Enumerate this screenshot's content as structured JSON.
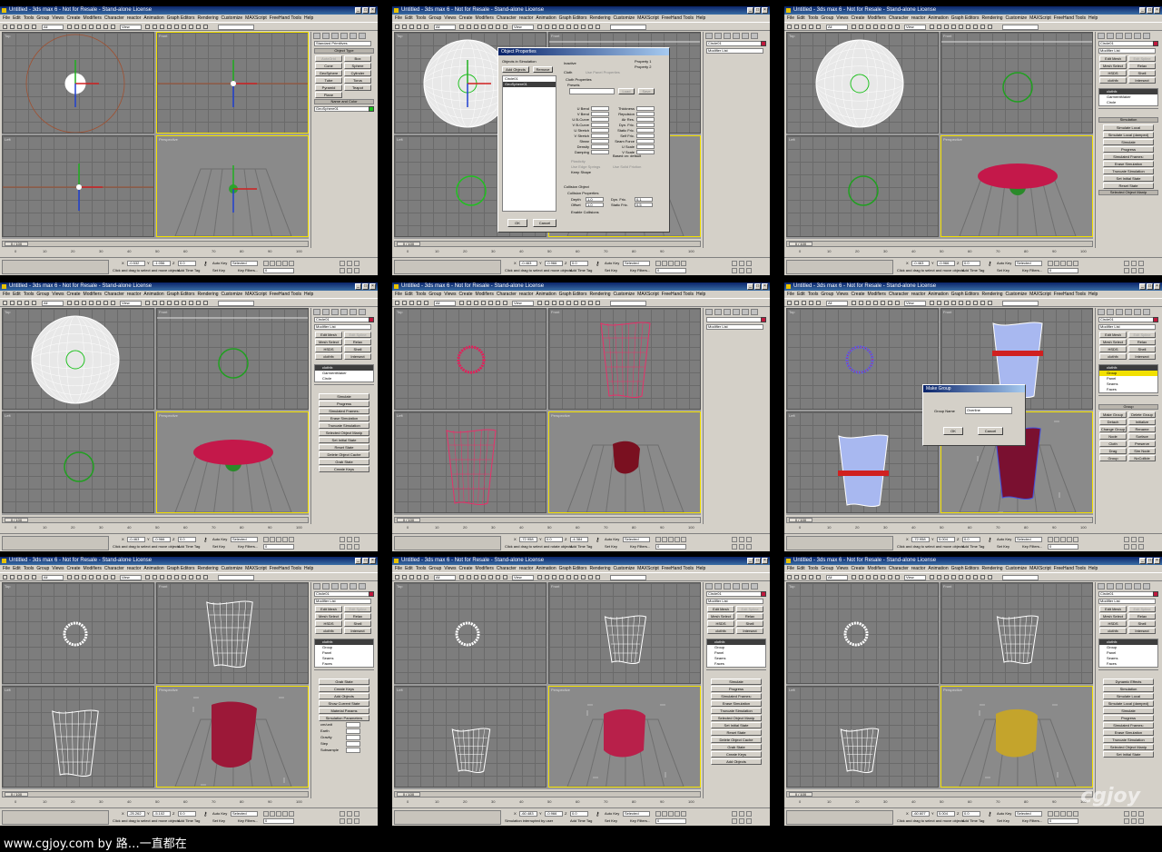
{
  "app": {
    "window_title": "Untitled - 3ds max 6 - Not for Resale - Stand-alone License",
    "menu": [
      "File",
      "Edit",
      "Tools",
      "Group",
      "Views",
      "Create",
      "Modifiers",
      "Character",
      "reactor",
      "Animation",
      "Graph Editors",
      "Rendering",
      "Customize",
      "MAXScript",
      "FreeHand Tools",
      "Help"
    ],
    "toolbar_dropdowns": [
      "All",
      "View"
    ],
    "viewport_labels": [
      "Top",
      "Front",
      "Left",
      "Perspective"
    ],
    "time_slider": "0 / 100",
    "ruler_ticks": [
      "0",
      "10",
      "20",
      "30",
      "40",
      "50",
      "60",
      "70",
      "80",
      "90",
      "100"
    ],
    "status": {
      "auto_key": "Auto Key",
      "set_key": "Set Key",
      "selected": "Selected",
      "key_filters": "Key Filters...",
      "add_time_tag": "Add Time Tag",
      "frame": "0",
      "prompt": "Click and drag to select and move objects"
    }
  },
  "panels": [
    {
      "id": "p1",
      "coords": [
        "-0.532",
        "-1.056",
        "0.0"
      ],
      "command_panel": {
        "dropdown": "Standard Primitives",
        "rollouts": [
          "Object Type",
          "Name and Color"
        ],
        "buttons": [
          "AutoGrid",
          "Box",
          "Cone",
          "Sphere",
          "GeoSphere",
          "Cylinder",
          "Tube",
          "Torus",
          "Pyramid",
          "Teapot",
          "Plane"
        ],
        "name_field": "GeoSphere01",
        "swatch": "#19c219"
      }
    },
    {
      "id": "p2",
      "coords": [
        "-0.463",
        "-0.966",
        "0.0"
      ],
      "command_panel": {
        "name_field": "Circle01",
        "modifier_list": "Modifier List",
        "swatch": "#c0183c"
      },
      "dialog": {
        "title": "Object Properties",
        "list_label": "Objects in Simulation",
        "add_button": "Add Objects",
        "remove_button": "Remove",
        "list_items": [
          "Circle01",
          "GeoSphere01"
        ],
        "radios": [
          "Inactive",
          "Cloth",
          "Property 1",
          "Property 2"
        ],
        "use_panel": "Use Panel Properties",
        "cloth_props": "Cloth Properties",
        "presets": "Presets",
        "load": "Load",
        "save": "Save",
        "left_fields": [
          "U Bend",
          "V Bend",
          "U B-Curve",
          "V B-Curve",
          "U Stretch",
          "V Stretch",
          "Shear",
          "Density",
          "Damping"
        ],
        "right_fields": [
          "Thickness",
          "Repulsion",
          "Air Res.",
          "Dyn. Fric.",
          "Static Fric.",
          "Self Fric.",
          "Seam Force",
          "U Scale",
          "V Scale"
        ],
        "checks": [
          "Plasticity",
          "Use Edge Springs",
          "Use Solid Friction",
          "Keep Shape"
        ],
        "based_on": "Based on: default",
        "collision_object": "Collision Object",
        "collision_props": "Collision Properties",
        "depth_label": "Depth",
        "depth_value": "1.0",
        "offset_label": "Offset",
        "offset_value": "1.0",
        "dyn_fric_label": "Dyn. Fric.",
        "dyn_fric_value": "0.1",
        "static_fric_label": "Static Fric.",
        "static_fric_value": "0.5",
        "enable_collisions": "Enable Collisions",
        "ok": "OK",
        "cancel": "Cancel"
      }
    },
    {
      "id": "p3",
      "coords": [
        "-0.463",
        "-0.966",
        "0.0"
      ],
      "command_panel": {
        "name_field": "Circle01",
        "modifier_list": "Modifier List",
        "swatch": "#c0183c",
        "buttons": [
          "Edit Mesh",
          "Edit Spline",
          "Mesh Select",
          "Relax",
          "HSDS",
          "Shell",
          "clothfx",
          "Intersect"
        ],
        "stack": [
          "clothfx",
          "GarmentMaker",
          "Circle"
        ],
        "rollouts": [
          "Simulation",
          "Selected Object Manip"
        ],
        "sim_buttons": [
          "Simulate Local",
          "Simulate Local (damped)",
          "Simulate",
          "Progress",
          "Simulated Frames:",
          "Erase Simulation",
          "Truncate Simulation",
          "Set Initial State",
          "Reset State"
        ]
      }
    },
    {
      "id": "p4",
      "coords": [
        "-0.463",
        "-0.966",
        "0.0"
      ],
      "command_panel": {
        "name_field": "Circle01",
        "modifier_list": "Modifier List",
        "swatch": "#c0183c",
        "buttons": [
          "Edit Mesh",
          "Edit Spline",
          "Mesh Select",
          "Relax",
          "HSDS",
          "Shell",
          "clothfx",
          "Intersect"
        ],
        "stack": [
          "clothfx",
          "GarmentMaker",
          "Circle"
        ],
        "sim_buttons": [
          "Simulate",
          "Progress",
          "Simulated Frames:",
          "Erase Simulation",
          "Truncate Simulation",
          "Selected Object Manip",
          "Set Initial State",
          "Reset State",
          "Delete Object Cache",
          "Grab State",
          "Create Keys"
        ]
      }
    },
    {
      "id": "p5",
      "coords": [
        "-72.958",
        "0.0",
        "-4.384"
      ],
      "prompt": "Click and drag to select and rotate objects",
      "command_panel": {
        "name_field": "",
        "modifier_list": "Modifier List",
        "swatch": "#c0183c"
      }
    },
    {
      "id": "p6",
      "coords": [
        "-72.958",
        "5.004",
        "0.0"
      ],
      "command_panel": {
        "name_field": "Circle01",
        "modifier_list": "Modifier List",
        "swatch": "#c0183c",
        "buttons": [
          "Edit Mesh",
          "Edit Spline",
          "Mesh Select",
          "Relax",
          "HSDS",
          "Shell",
          "clothfx",
          "Intersect"
        ],
        "stack": [
          "clothfx",
          "Group",
          "Panel",
          "Seams",
          "Faces"
        ],
        "group_rollout": "Group",
        "group_buttons": [
          "Make Group",
          "Delete Group",
          "Detach",
          "Initialize",
          "Change Group",
          "Rename",
          "Node",
          "Surface",
          "Cloth",
          "Preserve",
          "Drag",
          "Sim Node",
          "Group",
          "NoCollide"
        ]
      },
      "dialog": {
        "title": "Make Group",
        "label": "Group Name",
        "value": "Overline",
        "ok": "OK",
        "cancel": "Cancel"
      }
    },
    {
      "id": "p7",
      "coords": [
        "-25.262",
        "-5.102",
        "0.0"
      ],
      "command_panel": {
        "name_field": "Circle01",
        "modifier_list": "Modifier List",
        "swatch": "#c0183c",
        "buttons": [
          "Edit Mesh",
          "Edit Spline",
          "Mesh Select",
          "Relax",
          "HSDS",
          "Shell",
          "clothfx",
          "Intersect"
        ],
        "stack": [
          "clothfx",
          "Group",
          "Panel",
          "Seams",
          "Faces"
        ],
        "sim_buttons": [
          "Grab State",
          "Create Keys",
          "Add Objects",
          "Show Current State",
          "Material Params",
          "Simulation Parameters"
        ],
        "params": [
          "cm/unit",
          "Earth",
          "Gravity",
          "Step",
          "Subsample"
        ]
      }
    },
    {
      "id": "p8",
      "coords": [
        "-60.483",
        "-0.966",
        "0.0"
      ],
      "prompt": "Simulation interrupted by user",
      "command_panel": {
        "name_field": "Circle01",
        "modifier_list": "Modifier List",
        "swatch": "#c0183c",
        "buttons": [
          "Edit Mesh",
          "Edit Spline",
          "Mesh Select",
          "Relax",
          "HSDS",
          "Shell",
          "clothfx",
          "Intersect"
        ],
        "stack": [
          "clothfx",
          "Group",
          "Panel",
          "Seams",
          "Faces"
        ],
        "sim_buttons": [
          "Simulate",
          "Progress",
          "Simulated Frames:",
          "Erase Simulation",
          "Truncate Simulation",
          "Selected Object Manip",
          "Set Initial State",
          "Reset State",
          "Delete Object Cache",
          "Grab State",
          "Create Keys",
          "Add Objects"
        ]
      }
    },
    {
      "id": "p9",
      "coords": [
        "-60.607",
        "5.004",
        "0.0"
      ],
      "command_panel": {
        "name_field": "Circle01",
        "modifier_list": "Modifier List",
        "swatch": "#c0183c",
        "buttons": [
          "Edit Mesh",
          "Edit Spline",
          "Mesh Select",
          "Relax",
          "HSDS",
          "Shell",
          "clothfx",
          "Intersect"
        ],
        "stack": [
          "clothfx",
          "Group",
          "Panel",
          "Seams",
          "Faces"
        ],
        "sim_buttons": [
          "Dynamic Effects",
          "Simulation",
          "Simulate Local",
          "Simulate Local (damped)",
          "Simulate",
          "Progress",
          "Simulated Frames:",
          "Erase Simulation",
          "Truncate Simulation",
          "Selected Object Manip",
          "Set Initial State"
        ]
      }
    }
  ],
  "watermark": "cgjoy",
  "credit": "www.cgjoy.com by 路…一直都在"
}
